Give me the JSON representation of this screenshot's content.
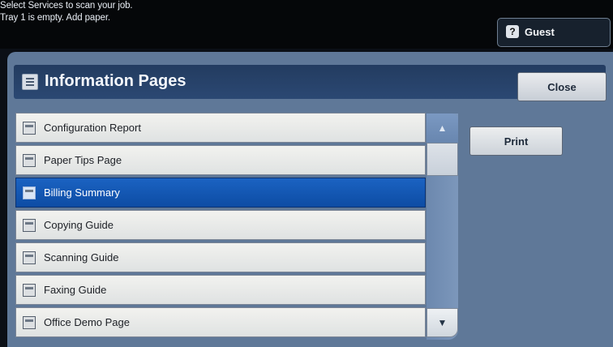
{
  "status": {
    "line1": "Select Services to scan your job.",
    "line2": "Tray 1 is empty.  Add paper."
  },
  "user": {
    "label": "Guest",
    "icon": "user-key-icon"
  },
  "header": {
    "title": "Information Pages",
    "icon": "information-pages-icon",
    "close_label": "Close"
  },
  "list": {
    "items": [
      {
        "label": "Configuration Report",
        "selected": false
      },
      {
        "label": "Paper Tips Page",
        "selected": false
      },
      {
        "label": "Billing Summary",
        "selected": true
      },
      {
        "label": "Copying Guide",
        "selected": false
      },
      {
        "label": "Scanning Guide",
        "selected": false
      },
      {
        "label": "Faxing Guide",
        "selected": false
      },
      {
        "label": "Office Demo Page",
        "selected": false
      }
    ],
    "item_icon": "document-icon"
  },
  "actions": {
    "print_label": "Print"
  },
  "scrollbar": {
    "up_icon": "arrow-up-icon",
    "down_icon": "arrow-down-icon"
  },
  "colors": {
    "selected": "#1558b8",
    "panel": "#5f7898",
    "title_bar": "#25406a"
  }
}
